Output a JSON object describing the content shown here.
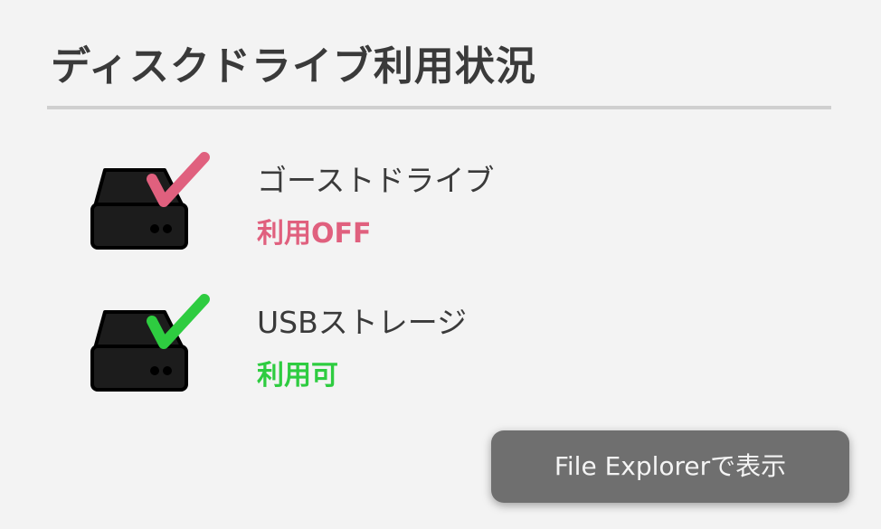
{
  "panel": {
    "title": "ディスクドライブ利用状況"
  },
  "drives": [
    {
      "name": "ゴーストドライブ",
      "status": "利用OFF",
      "status_color": "#e0607e",
      "icon": "hard-drive-icon",
      "check_icon": "checkmark-icon"
    },
    {
      "name": "USBストレージ",
      "status": "利用可",
      "status_color": "#2ecc40",
      "icon": "hard-drive-icon",
      "check_icon": "checkmark-icon"
    }
  ],
  "actions": {
    "explorer_button_label": "File Explorerで表示"
  },
  "colors": {
    "background": "#f3f3f3",
    "divider": "#cfcfcf",
    "button": "#6f6f6f",
    "drive_body": "#1c1c1c"
  }
}
